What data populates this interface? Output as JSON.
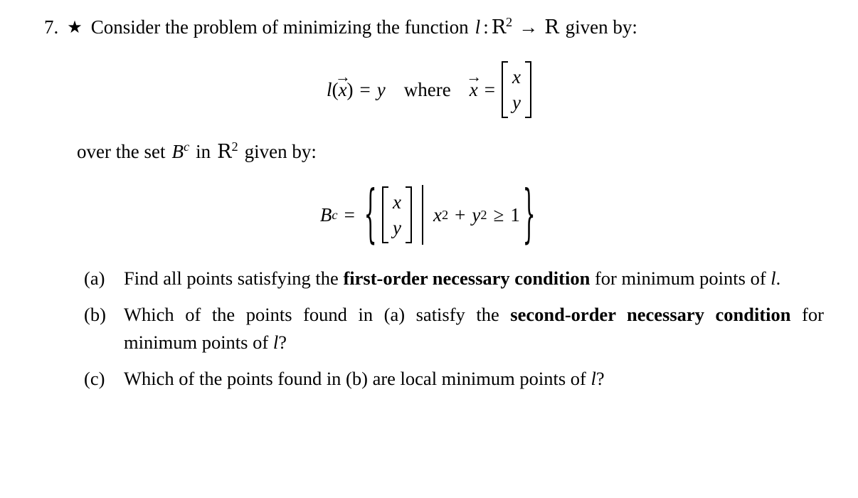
{
  "document": {
    "problem_number": "7.",
    "star_marker": "★",
    "background_color": "#ffffff",
    "text_color": "#000000"
  },
  "statement": {
    "lead_text_1": "Consider the problem of minimizing the function",
    "function_symbol": "l",
    "colon": ":",
    "domain_symbol": "R",
    "domain_exponent": "2",
    "arrow": "→",
    "codomain_symbol": "R",
    "lead_text_2": "given by:"
  },
  "equation_function": {
    "lhs_function": "l",
    "paren_open": "(",
    "vector_var": "x",
    "vector_arrow": "⃗",
    "paren_close": ")",
    "equals": "=",
    "rhs": "y",
    "where_word": "where",
    "vec_lhs": "x",
    "equals_2": "=",
    "vector_components": [
      "x",
      "y"
    ]
  },
  "over_set_line": {
    "prefix": "over the set",
    "set_symbol": "B",
    "set_exponent": "c",
    "in_word": "in",
    "space_symbol": "R",
    "space_exponent": "2",
    "suffix": "given by:"
  },
  "equation_set": {
    "set_symbol": "B",
    "set_exponent": "c",
    "equals": "=",
    "brace_open": "{",
    "vector_components": [
      "x",
      "y"
    ],
    "separator": "|",
    "constraint_x": "x",
    "constraint_x_exp": "2",
    "plus": "+",
    "constraint_y": "y",
    "constraint_y_exp": "2",
    "relation": "≥",
    "bound": "1",
    "brace_close": "}"
  },
  "parts": [
    {
      "label": "(a)",
      "segments": [
        {
          "text": "Find all points satisfying the ",
          "bold": false
        },
        {
          "text": "first-order necessary condition",
          "bold": true
        },
        {
          "text": " for minimum points of ",
          "bold": false
        },
        {
          "text": "l",
          "bold": false,
          "italic": true
        },
        {
          "text": ".",
          "bold": false
        }
      ]
    },
    {
      "label": "(b)",
      "segments": [
        {
          "text": "Which of the points found in (a) satisfy the ",
          "bold": false
        },
        {
          "text": "second-order necessary condition",
          "bold": true
        },
        {
          "text": " for minimum points of ",
          "bold": false
        },
        {
          "text": "l",
          "bold": false,
          "italic": true
        },
        {
          "text": "?",
          "bold": false
        }
      ]
    },
    {
      "label": "(c)",
      "segments": [
        {
          "text": "Which of the points found in (b) are local minimum points of ",
          "bold": false
        },
        {
          "text": "l",
          "bold": false,
          "italic": true
        },
        {
          "text": "?",
          "bold": false
        }
      ]
    }
  ]
}
